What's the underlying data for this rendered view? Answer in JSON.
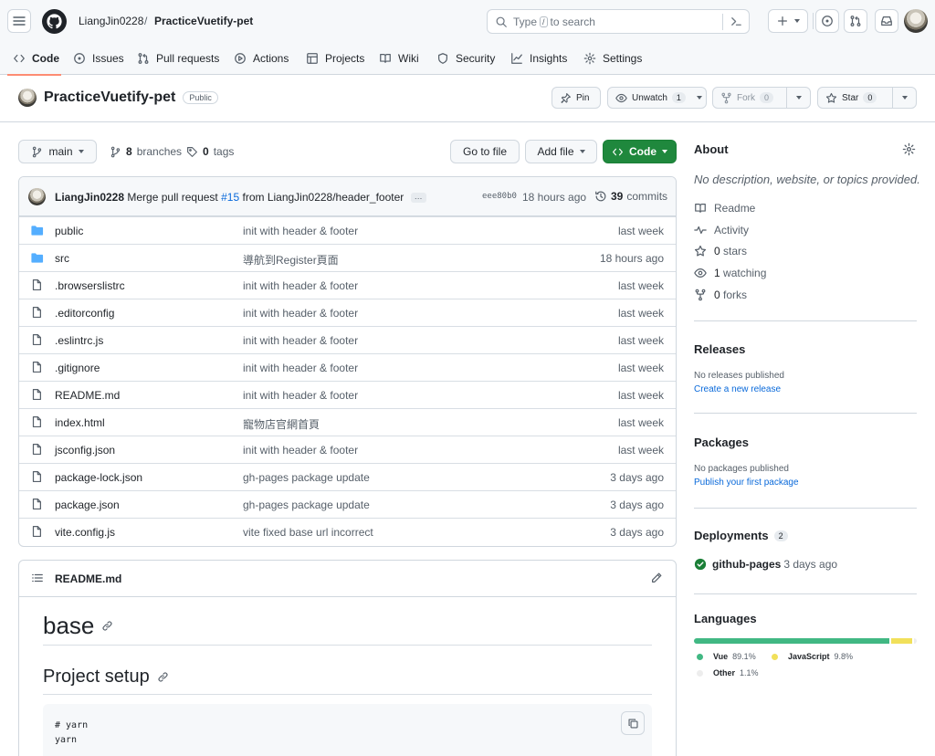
{
  "header": {
    "owner": "LiangJin0228",
    "separator": "/",
    "repo": "PracticeVuetify-pet",
    "search": {
      "prefix": "Type",
      "key": "/",
      "suffix": "to search"
    },
    "plus_label": "+"
  },
  "tabs": [
    {
      "label": "Code",
      "icon": "code-icon"
    },
    {
      "label": "Issues",
      "icon": "issue-icon"
    },
    {
      "label": "Pull requests",
      "icon": "pull-request-icon"
    },
    {
      "label": "Actions",
      "icon": "play-icon"
    },
    {
      "label": "Projects",
      "icon": "table-icon"
    },
    {
      "label": "Wiki",
      "icon": "book-icon"
    },
    {
      "label": "Security",
      "icon": "shield-icon"
    },
    {
      "label": "Insights",
      "icon": "graph-icon"
    },
    {
      "label": "Settings",
      "icon": "gear-icon"
    }
  ],
  "repo_header": {
    "title": "PracticeVuetify-pet",
    "visibility": "Public",
    "pin_label": "Pin",
    "watch_label": "Unwatch",
    "watch_count": "1",
    "fork_label": "Fork",
    "fork_count": "0",
    "star_label": "Star",
    "star_count": "0"
  },
  "file_nav": {
    "branch": "main",
    "branches_count": "8",
    "branches_label": "branches",
    "tags_count": "0",
    "tags_label": "tags",
    "go_to_file": "Go to file",
    "add_file": "Add file",
    "code_button": "Code"
  },
  "latest_commit": {
    "author": "LiangJin0228",
    "message_prefix": "Merge pull request",
    "pr": "#15",
    "message_suffix": "from LiangJin0228/header_footer",
    "ellipsis": "…",
    "hash": "eee80b0",
    "time": "18 hours ago",
    "commits_count": "39",
    "commits_label": "commits"
  },
  "files": [
    {
      "type": "dir",
      "name": "public",
      "message": "init with header & footer",
      "date": "last week"
    },
    {
      "type": "dir",
      "name": "src",
      "message": "導航到Register頁面",
      "date": "18 hours ago"
    },
    {
      "type": "file",
      "name": ".browserslistrc",
      "message": "init with header & footer",
      "date": "last week"
    },
    {
      "type": "file",
      "name": ".editorconfig",
      "message": "init with header & footer",
      "date": "last week"
    },
    {
      "type": "file",
      "name": ".eslintrc.js",
      "message": "init with header & footer",
      "date": "last week"
    },
    {
      "type": "file",
      "name": ".gitignore",
      "message": "init with header & footer",
      "date": "last week"
    },
    {
      "type": "file",
      "name": "README.md",
      "message": "init with header & footer",
      "date": "last week"
    },
    {
      "type": "file",
      "name": "index.html",
      "message": "寵物店官網首頁",
      "date": "last week"
    },
    {
      "type": "file",
      "name": "jsconfig.json",
      "message": "init with header & footer",
      "date": "last week"
    },
    {
      "type": "file",
      "name": "package-lock.json",
      "message": "gh-pages package update",
      "date": "3 days ago"
    },
    {
      "type": "file",
      "name": "package.json",
      "message": "gh-pages package update",
      "date": "3 days ago"
    },
    {
      "type": "file",
      "name": "vite.config.js",
      "message": "vite fixed base url incorrect",
      "date": "3 days ago"
    }
  ],
  "readme": {
    "file": "README.md",
    "h1": "base",
    "h2": "Project setup",
    "code_line1": "# yarn",
    "code_line2": "yarn"
  },
  "about": {
    "title": "About",
    "description": "No description, website, or topics provided.",
    "readme": "Readme",
    "activity": "Activity",
    "stars_count": "0",
    "stars_label": "stars",
    "watching_count": "1",
    "watching_label": "watching",
    "forks_count": "0",
    "forks_label": "forks"
  },
  "releases": {
    "title": "Releases",
    "empty": "No releases published",
    "link": "Create a new release"
  },
  "packages": {
    "title": "Packages",
    "empty": "No packages published",
    "link": "Publish your first package"
  },
  "deployments": {
    "title": "Deployments",
    "count": "2",
    "name": "github-pages",
    "time": "3 days ago"
  },
  "languages": {
    "title": "Languages",
    "items": [
      {
        "name": "Vue",
        "percent": "89.1%",
        "value": 89.1,
        "color": "#41b883"
      },
      {
        "name": "JavaScript",
        "percent": "9.8%",
        "value": 9.8,
        "color": "#f1e05a"
      },
      {
        "name": "Other",
        "percent": "1.1%",
        "value": 1.1,
        "color": "#ededed"
      }
    ]
  }
}
